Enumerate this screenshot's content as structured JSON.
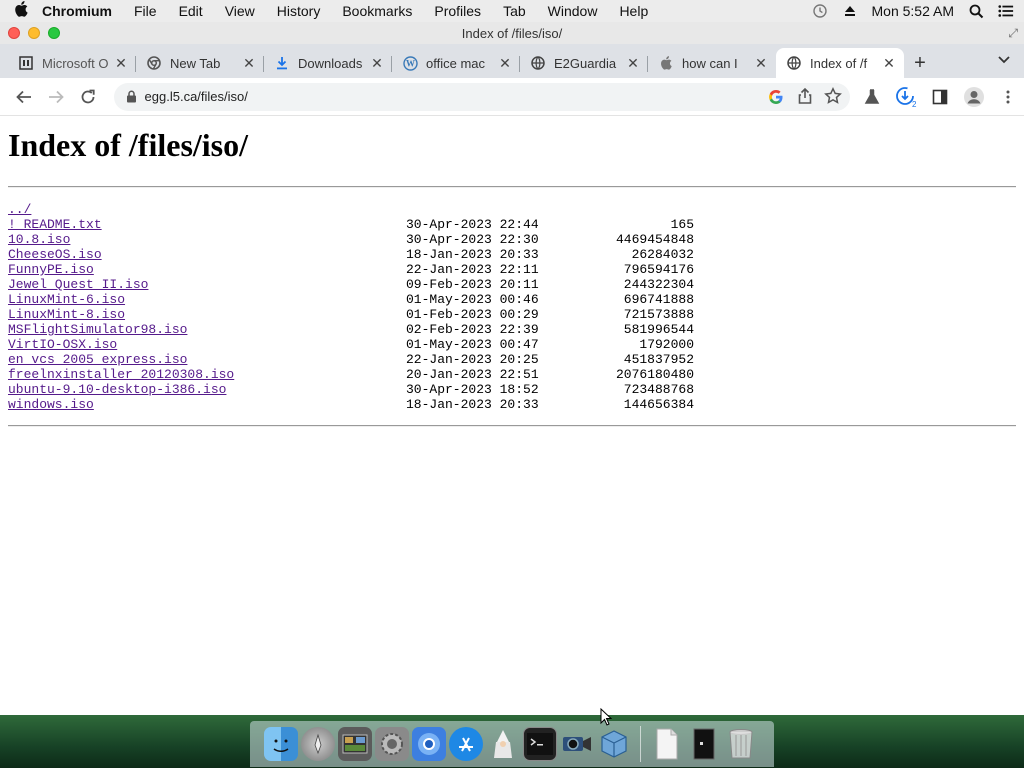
{
  "menubar": {
    "app_name": "Chromium",
    "items": [
      "File",
      "Edit",
      "View",
      "History",
      "Bookmarks",
      "Profiles",
      "Tab",
      "Window",
      "Help"
    ],
    "clock": "Mon 5:52 AM"
  },
  "window": {
    "title": "Index of /files/iso/"
  },
  "tabs": [
    {
      "label": "Microsoft O",
      "favicon": "microsoft-icon",
      "active": false
    },
    {
      "label": "New Tab",
      "favicon": "chrome-icon",
      "active": false
    },
    {
      "label": "Downloads",
      "favicon": "download-icon",
      "active": false
    },
    {
      "label": "office mac",
      "favicon": "wordpress-icon",
      "active": false
    },
    {
      "label": "E2Guardia",
      "favicon": "globe-icon",
      "active": false
    },
    {
      "label": "how can I",
      "favicon": "apple-icon",
      "active": false
    },
    {
      "label": "Index of /f",
      "favicon": "globe-icon",
      "active": true
    }
  ],
  "toolbar": {
    "url": "egg.l5.ca/files/iso/",
    "download_badge": "2"
  },
  "page": {
    "heading": "Index of /files/iso/",
    "parent_link": "../",
    "files": [
      {
        "name": "! README.txt",
        "date": "30-Apr-2023 22:44",
        "size": "165"
      },
      {
        "name": "10.8.iso",
        "date": "30-Apr-2023 22:30",
        "size": "4469454848"
      },
      {
        "name": "CheeseOS.iso",
        "date": "18-Jan-2023 20:33",
        "size": "26284032"
      },
      {
        "name": "FunnyPE.iso",
        "date": "22-Jan-2023 22:11",
        "size": "796594176"
      },
      {
        "name": "Jewel Quest II.iso",
        "date": "09-Feb-2023 20:11",
        "size": "244322304"
      },
      {
        "name": "LinuxMint-6.iso",
        "date": "01-May-2023 00:46",
        "size": "696741888"
      },
      {
        "name": "LinuxMint-8.iso",
        "date": "01-Feb-2023 00:29",
        "size": "721573888"
      },
      {
        "name": "MSFlightSimulator98.iso",
        "date": "02-Feb-2023 22:39",
        "size": "581996544"
      },
      {
        "name": "VirtIO-OSX.iso",
        "date": "01-May-2023 00:47",
        "size": "1792000"
      },
      {
        "name": "en_vcs_2005_express.iso",
        "date": "22-Jan-2023 20:25",
        "size": "451837952"
      },
      {
        "name": "freelnxinstaller_20120308.iso",
        "date": "20-Jan-2023 22:51",
        "size": "2076180480"
      },
      {
        "name": "ubuntu-9.10-desktop-i386.iso",
        "date": "30-Apr-2023 18:52",
        "size": "723488768"
      },
      {
        "name": "windows.iso",
        "date": "18-Jan-2023 20:33",
        "size": "144656384"
      }
    ]
  },
  "dock": {
    "apps": [
      "finder-icon",
      "launchpad-icon",
      "photo-browser-icon",
      "system-preferences-icon",
      "chromium-icon",
      "app-store-icon",
      "wizard-icon",
      "terminal-icon",
      "camera-icon",
      "virtualbox-icon"
    ],
    "trailing": [
      "document-icon",
      "terminal-window-icon",
      "trash-icon"
    ]
  },
  "colors": {
    "link": "#551a8b",
    "tabstrip": "#dee1e6",
    "omnibox": "#f1f3f4",
    "download_accent": "#1a73e8"
  }
}
